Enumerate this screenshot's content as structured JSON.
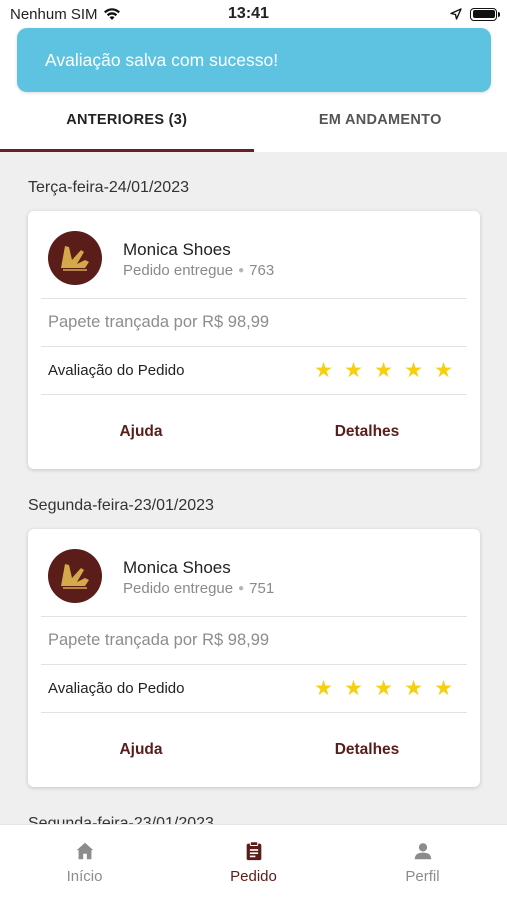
{
  "status_bar": {
    "carrier": "Nenhum SIM",
    "time": "13:41"
  },
  "toast": {
    "message": "Avaliação salva com sucesso!"
  },
  "tabs": [
    {
      "label": "ANTERIORES (3)",
      "active": true
    },
    {
      "label": "EM ANDAMENTO",
      "active": false
    }
  ],
  "orders": [
    {
      "date": "Terça-feira-24/01/2023",
      "store": "Monica Shoes",
      "status": "Pedido entregue",
      "order_number": "763",
      "item": "Papete trançada por R$ 98,99",
      "rating_label": "Avaliação do Pedido",
      "rating": 5,
      "help_label": "Ajuda",
      "details_label": "Detalhes"
    },
    {
      "date": "Segunda-feira-23/01/2023",
      "store": "Monica Shoes",
      "status": "Pedido entregue",
      "order_number": "751",
      "item": "Papete trançada por R$ 98,99",
      "rating_label": "Avaliação do Pedido",
      "rating": 5,
      "help_label": "Ajuda",
      "details_label": "Detalhes"
    },
    {
      "date": "Segunda-feira-23/01/2023"
    }
  ],
  "bottom_nav": [
    {
      "label": "Início",
      "icon": "home-icon",
      "active": false
    },
    {
      "label": "Pedido",
      "icon": "clipboard-icon",
      "active": true
    },
    {
      "label": "Perfil",
      "icon": "person-icon",
      "active": false
    }
  ],
  "colors": {
    "brand": "#5a1d1a",
    "toast": "#5ec3e0",
    "star": "#f5cf10"
  }
}
